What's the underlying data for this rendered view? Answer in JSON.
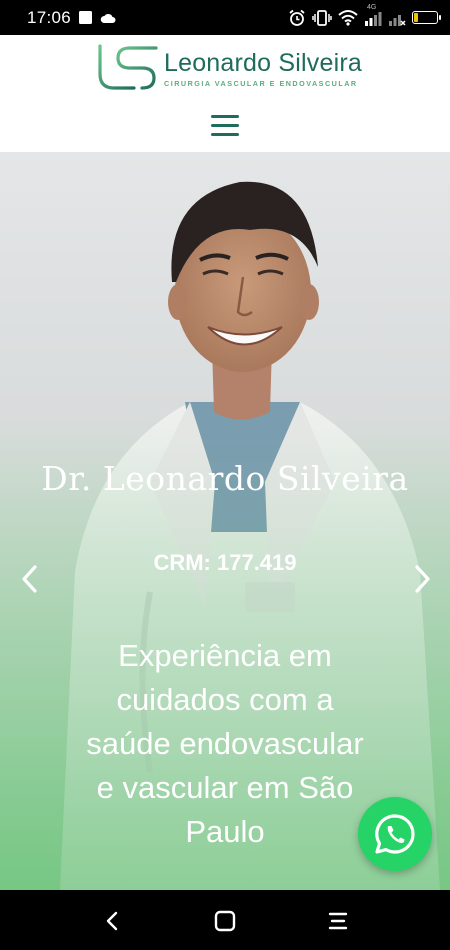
{
  "status_bar": {
    "time": "17:06",
    "network_label": "4G",
    "battery_level": "19",
    "battery_fraction": 0.19
  },
  "header": {
    "brand_name": "Leonardo Silveira",
    "brand_tagline": "CIRURGIA VASCULAR E ENDOVASCULAR",
    "menu_icon": "hamburger-icon",
    "brand_colors": {
      "dark": "#1f6b5c",
      "light": "#5aae7d"
    }
  },
  "hero": {
    "name": "Dr. Leonardo Silveira",
    "crm": "CRM: 177.419",
    "tagline": "Experiência em cuidados com a saúde endovascular e vascular em São Paulo",
    "prev_icon": "chevron-left-icon",
    "next_icon": "chevron-right-icon"
  },
  "whatsapp": {
    "icon": "whatsapp-icon",
    "color": "#25d366"
  },
  "nav_bar": {
    "back_icon": "back-icon",
    "home_icon": "home-icon",
    "recents_icon": "recents-icon"
  }
}
